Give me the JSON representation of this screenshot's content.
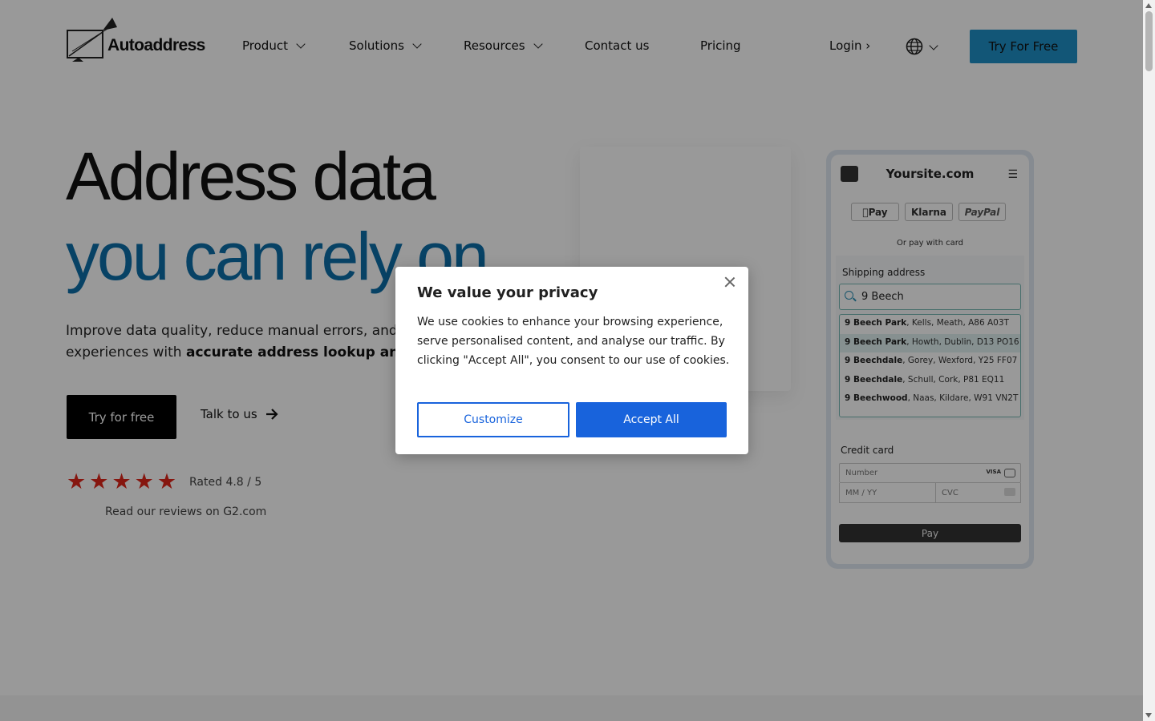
{
  "header": {
    "logo_text": "Autoaddress",
    "nav": [
      {
        "label": "Product",
        "dropdown": true
      },
      {
        "label": "Solutions",
        "dropdown": true
      },
      {
        "label": "Resources",
        "dropdown": true
      },
      {
        "label": "Contact us",
        "dropdown": false
      },
      {
        "label": "Pricing",
        "dropdown": false
      }
    ],
    "login_label": "Login ›",
    "language_icon": "globe-icon",
    "cta_label": "Try For Free"
  },
  "hero": {
    "title_line1": "Address data",
    "title_line2": "you can rely on",
    "desc_start": "Improve data quality, reduce manual errors, and de",
    "desc_line2_start": "experiences with ",
    "desc_bold": "accurate address lookup and ve",
    "primary_cta": "Try for free",
    "secondary_cta": "Talk to us",
    "stars": 5,
    "rating_text": "Rated 4.8 / 5",
    "reviews_link": "Read our reviews on G2.com"
  },
  "phone": {
    "site": "Yoursite.com",
    "pay_buttons": [
      "Pay",
      "Klarna",
      "PayPal"
    ],
    "or_pay": "Or pay with card",
    "shipping_label": "Shipping address",
    "search_value": "9 Beech",
    "suggestions": [
      {
        "bold": "9 Beech Park",
        "rest": ", Kells, Meath, A86 A03T"
      },
      {
        "bold": "9 Beech Park",
        "rest": ", Howth, Dublin, D13 PO16"
      },
      {
        "bold": "9 Beechdale",
        "rest": ", Gorey, Wexford, Y25 FF07"
      },
      {
        "bold": "9 Beechdale",
        "rest": ", Schull, Cork, P81 EQ11"
      },
      {
        "bold": "9 Beechwood",
        "rest": ", Naas, Kildare, W91 VN2T"
      }
    ],
    "credit_label": "Credit card",
    "number_placeholder": "Number",
    "visa_label": "VISA",
    "mm_placeholder": "MM / YY",
    "cvc_placeholder": "CVC",
    "pay_label": "Pay"
  },
  "cookie_modal": {
    "title": "We value your privacy",
    "body": "We use cookies to enhance your browsing experience, serve personalised content, and analyse our traffic. By clicking \"Accept All\", you consent to our use of cookies.",
    "customize_label": "Customize",
    "accept_label": "Accept All"
  },
  "colors": {
    "brand_blue": "#0c6ea8",
    "cta_blue": "#1f8fc7",
    "accept_blue": "#1863dc",
    "star_red": "#e0261a"
  }
}
